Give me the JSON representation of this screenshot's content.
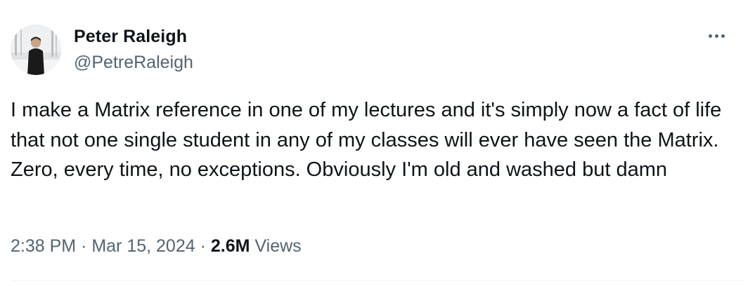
{
  "author": {
    "display_name": "Peter Raleigh",
    "handle": "@PetreRaleigh"
  },
  "more_options_icon": "ellipsis-icon",
  "tweet": {
    "text": "I make a Matrix reference in one of my lectures and it's simply now a fact of life that not one single student in any of my classes will ever have seen the Matrix. Zero, every time, no exceptions. Obviously I'm old and washed but damn"
  },
  "meta": {
    "time": "2:38 PM",
    "separator": " · ",
    "date": "Mar 15, 2024",
    "views_count": "2.6M",
    "views_label": "Views"
  },
  "colors": {
    "text_primary": "#0f1419",
    "text_secondary": "#536471",
    "divider": "#eff3f4"
  }
}
